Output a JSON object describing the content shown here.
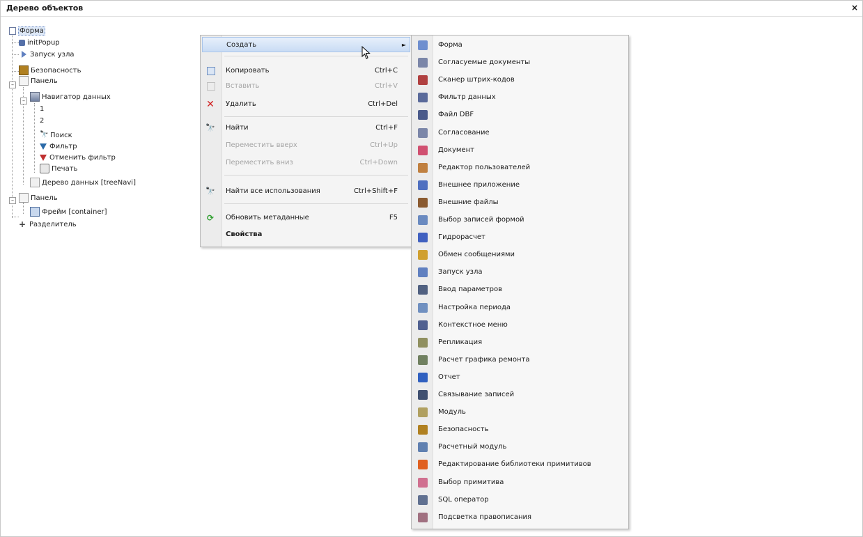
{
  "window": {
    "title": "Дерево объектов",
    "close": "×"
  },
  "tree": [
    {
      "label": "Форма",
      "icon": "form-icon"
    },
    {
      "label": "initPopup",
      "icon": "popup-icon"
    },
    {
      "label": "Запуск узла",
      "icon": "run-node-icon"
    },
    {
      "label": "Безопасность",
      "icon": "security-icon"
    },
    {
      "label": "Панель",
      "icon": "panel-icon"
    },
    {
      "label": "Навигатор данных",
      "icon": "data-navigator-icon"
    },
    {
      "label": "1",
      "icon": ""
    },
    {
      "label": "2",
      "icon": ""
    },
    {
      "label": "Поиск",
      "icon": "binoculars-icon"
    },
    {
      "label": "Фильтр",
      "icon": "filter-icon"
    },
    {
      "label": "Отменить фильтр",
      "icon": "cancel-filter-icon"
    },
    {
      "label": "Печать",
      "icon": "printer-icon"
    },
    {
      "label": "Дерево данных [treeNavi]",
      "icon": "tree-icon"
    },
    {
      "label": "Панель",
      "icon": "panel-icon"
    },
    {
      "label": "Фрейм [container]",
      "icon": "frame-icon"
    },
    {
      "label": "Разделитель",
      "icon": "splitter-icon"
    }
  ],
  "context_menu": {
    "items": [
      {
        "label": "Создать",
        "shortcut": "",
        "icon": "",
        "arrow": "►",
        "state": "highlighted"
      },
      {
        "label": "Копировать",
        "shortcut": "Ctrl+C",
        "icon": "copy-icon",
        "state": "enabled"
      },
      {
        "label": "Вставить",
        "shortcut": "Ctrl+V",
        "icon": "paste-icon",
        "state": "disabled"
      },
      {
        "label": "Удалить",
        "shortcut": "Ctrl+Del",
        "icon": "delete-icon",
        "state": "enabled"
      },
      {
        "label": "Найти",
        "shortcut": "Ctrl+F",
        "icon": "binoculars-icon",
        "state": "enabled"
      },
      {
        "label": "Переместить вверх",
        "shortcut": "Ctrl+Up",
        "icon": "",
        "state": "disabled"
      },
      {
        "label": "Переместить вниз",
        "shortcut": "Ctrl+Down",
        "icon": "",
        "state": "disabled"
      },
      {
        "label": "Найти все использования",
        "shortcut": "Ctrl+Shift+F",
        "icon": "binoculars-icon",
        "state": "enabled"
      },
      {
        "label": "Обновить метаданные",
        "shortcut": "F5",
        "icon": "refresh-icon",
        "state": "enabled"
      },
      {
        "label": "Свойства",
        "shortcut": "",
        "icon": "",
        "state": "bold"
      }
    ]
  },
  "submenu": {
    "items": [
      {
        "label": "Форма",
        "icon": "form-icon",
        "color": "#6f8fcf"
      },
      {
        "label": "Согласуемые документы",
        "icon": "documents-icon",
        "color": "#7b86a8"
      },
      {
        "label": "Сканер штрих-кодов",
        "icon": "barcode-scanner-icon",
        "color": "#b04040"
      },
      {
        "label": "Фильтр данных",
        "icon": "data-filter-icon",
        "color": "#5a6a9a"
      },
      {
        "label": "Файл DBF",
        "icon": "dbf-file-icon",
        "color": "#4a5a8a"
      },
      {
        "label": "Согласование",
        "icon": "approval-icon",
        "color": "#7b86a8"
      },
      {
        "label": "Документ",
        "icon": "document-icon",
        "color": "#d05070"
      },
      {
        "label": "Редактор пользователей",
        "icon": "user-editor-icon",
        "color": "#c08040"
      },
      {
        "label": "Внешнее приложение",
        "icon": "external-app-icon",
        "color": "#5070c0"
      },
      {
        "label": "Внешние файлы",
        "icon": "external-files-icon",
        "color": "#8a5a30"
      },
      {
        "label": "Выбор записей формой",
        "icon": "record-select-icon",
        "color": "#6a8ac0"
      },
      {
        "label": "Гидрорасчет",
        "icon": "hydro-calc-icon",
        "color": "#4060c0"
      },
      {
        "label": "Обмен сообщениями",
        "icon": "messaging-icon",
        "color": "#d0a030"
      },
      {
        "label": "Запуск узла",
        "icon": "run-node-icon",
        "color": "#6080c0"
      },
      {
        "label": "Ввод параметров",
        "icon": "params-input-icon",
        "color": "#506080"
      },
      {
        "label": "Настройка периода",
        "icon": "period-settings-icon",
        "color": "#7090c0"
      },
      {
        "label": "Контекстное меню",
        "icon": "context-menu-icon",
        "color": "#506090"
      },
      {
        "label": "Репликация",
        "icon": "replication-icon",
        "color": "#909060"
      },
      {
        "label": "Расчет графика ремонта",
        "icon": "repair-schedule-icon",
        "color": "#708060"
      },
      {
        "label": "Отчет",
        "icon": "report-icon",
        "color": "#3060c0"
      },
      {
        "label": "Связывание записей",
        "icon": "link-records-icon",
        "color": "#405070"
      },
      {
        "label": "Модуль",
        "icon": "module-icon",
        "color": "#b0a060"
      },
      {
        "label": "Безопасность",
        "icon": "security-icon",
        "color": "#b08020"
      },
      {
        "label": "Расчетный модуль",
        "icon": "calc-module-icon",
        "color": "#6080b0"
      },
      {
        "label": "Редактирование библиотеки примитивов",
        "icon": "primitive-library-icon",
        "color": "#e06020"
      },
      {
        "label": "Выбор примитива",
        "icon": "primitive-select-icon",
        "color": "#d07090"
      },
      {
        "label": "SQL оператор",
        "icon": "sql-operator-icon",
        "color": "#607090"
      },
      {
        "label": "Подсветка правописания",
        "icon": "spellcheck-icon",
        "color": "#a07080"
      }
    ]
  }
}
